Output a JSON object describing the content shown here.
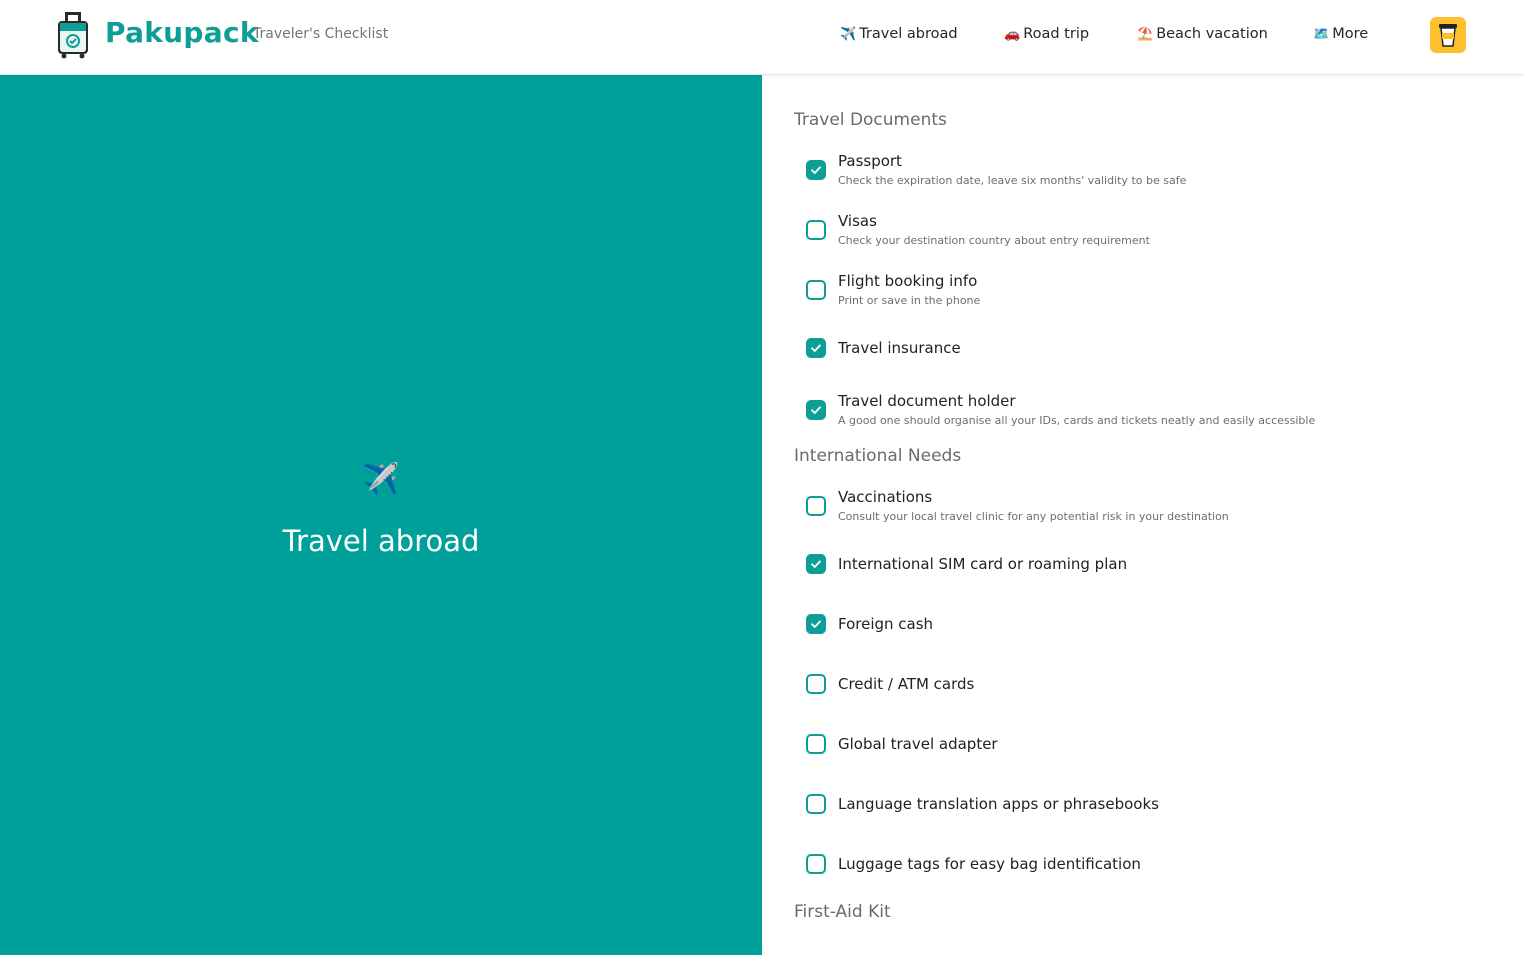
{
  "header": {
    "brand": "Pakupack",
    "tagline": "Traveler's Checklist",
    "nav": [
      {
        "icon": "✈️",
        "label": "Travel abroad",
        "icon_name": "airplane-icon"
      },
      {
        "icon": "🚗",
        "label": "Road trip",
        "icon_name": "car-icon"
      },
      {
        "icon": "⛱️",
        "label": "Beach vacation",
        "icon_name": "beach-umbrella-icon"
      },
      {
        "icon": "🗺️",
        "label": "More",
        "icon_name": "map-icon"
      }
    ],
    "coffee_icon": "coffee-cup-icon"
  },
  "hero": {
    "icon": "✈️",
    "title": "Travel abroad"
  },
  "sections": [
    {
      "title": "Travel Documents",
      "items": [
        {
          "label": "Passport",
          "note": "Check the expiration date, leave six months' validity to be safe",
          "checked": true
        },
        {
          "label": "Visas",
          "note": "Check your destination country about entry requirement",
          "checked": false
        },
        {
          "label": "Flight booking info",
          "note": "Print or save in the phone",
          "checked": false
        },
        {
          "label": "Travel insurance",
          "note": "",
          "checked": true
        },
        {
          "label": "Travel document holder",
          "note": "A good one should organise all your IDs, cards and tickets neatly and easily accessible",
          "checked": true
        }
      ]
    },
    {
      "title": "International Needs",
      "items": [
        {
          "label": "Vaccinations",
          "note": "Consult your local travel clinic for any potential risk in your destination",
          "checked": false
        },
        {
          "label": "International SIM card or roaming plan",
          "note": "",
          "checked": true
        },
        {
          "label": "Foreign cash",
          "note": "",
          "checked": true
        },
        {
          "label": "Credit / ATM cards",
          "note": "",
          "checked": false
        },
        {
          "label": "Global travel adapter",
          "note": "",
          "checked": false
        },
        {
          "label": "Language translation apps or phrasebooks",
          "note": "",
          "checked": false
        },
        {
          "label": "Luggage tags for easy bag identification",
          "note": "",
          "checked": false
        }
      ]
    },
    {
      "title": "First-Aid Kit",
      "items": []
    }
  ],
  "colors": {
    "accent": "#0e9e96",
    "hero_bg": "#00a09a",
    "coffee_bg": "#ffc02e"
  }
}
